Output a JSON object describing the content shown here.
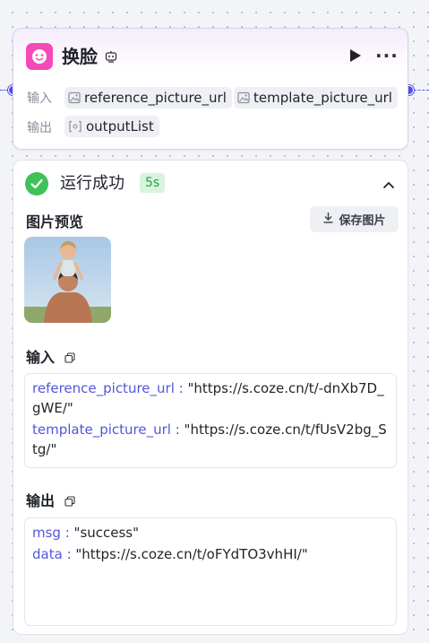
{
  "node": {
    "title": "换脸",
    "input_label": "输入",
    "output_label": "输出",
    "inputs": [
      "reference_picture_url",
      "template_picture_url"
    ],
    "outputs": [
      "outputList"
    ]
  },
  "result": {
    "status": "运行成功",
    "duration": "5s",
    "preview_title": "图片预览",
    "save_label": "保存图片",
    "input_title": "输入",
    "output_title": "输出",
    "input_fields": [
      {
        "key": "reference_picture_url",
        "sep": " : ",
        "value": "\"https://s.coze.cn/t/-dnXb7D_gWE/\""
      },
      {
        "key": "template_picture_url",
        "sep": " : ",
        "value": "\"https://s.coze.cn/t/fUsV2bg_Stg/\""
      }
    ],
    "output_fields": [
      {
        "key": "msg",
        "sep": " : ",
        "value": "\"success\""
      },
      {
        "key": "data",
        "sep": " : ",
        "value": "\"https://s.coze.cn/t/oFYdTO3vhHI/\""
      }
    ]
  },
  "colors": {
    "accent": "#4e51e4",
    "node_icon": "#f34ab7",
    "success": "#3ec25a",
    "key_text": "#5257d8"
  },
  "icons": [
    "face-icon",
    "robot-icon",
    "play-icon",
    "more-icon",
    "image-icon",
    "array-icon",
    "check-icon",
    "chevron-up-icon",
    "download-icon",
    "copy-icon"
  ]
}
